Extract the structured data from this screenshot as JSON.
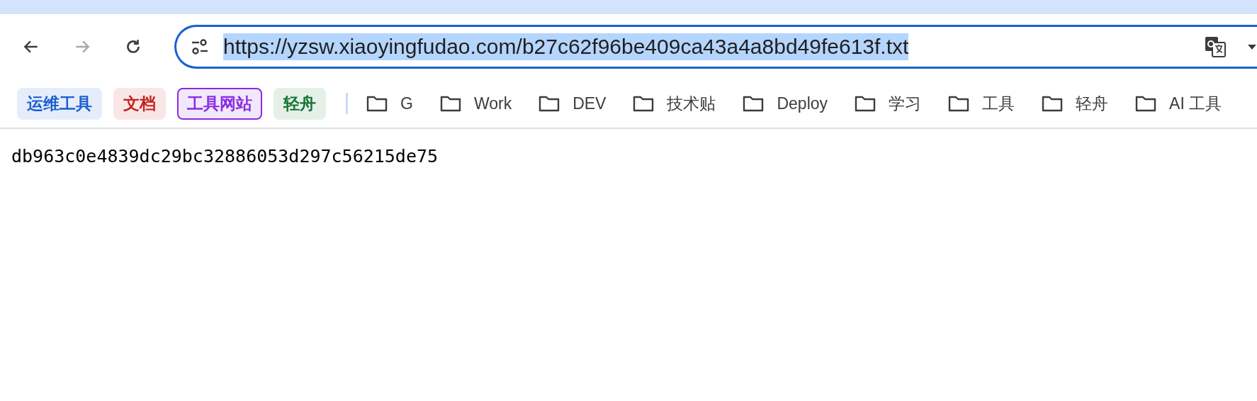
{
  "toolbar": {
    "back_disabled": false,
    "forward_disabled": true
  },
  "address_bar": {
    "url": "https://yzsw.xiaoyingfudao.com/b27c62f96be409ca43a4a8bd49fe613f.txt",
    "url_selected": true
  },
  "tab_groups": [
    {
      "label": "运维工具",
      "color": "#1a5fd0",
      "selected": false
    },
    {
      "label": "文档",
      "color": "#c5221f",
      "selected": false
    },
    {
      "label": "工具网站",
      "color": "#8a2be2",
      "selected": true
    },
    {
      "label": "轻舟",
      "color": "#137333",
      "selected": false
    }
  ],
  "bookmarks": [
    {
      "label": "G"
    },
    {
      "label": "Work"
    },
    {
      "label": "DEV"
    },
    {
      "label": "技术贴"
    },
    {
      "label": "Deploy"
    },
    {
      "label": "学习"
    },
    {
      "label": "工具"
    },
    {
      "label": "轻舟"
    },
    {
      "label": "AI 工具"
    }
  ],
  "page_text": "db963c0e4839dc29bc32886053d297c56215de75"
}
